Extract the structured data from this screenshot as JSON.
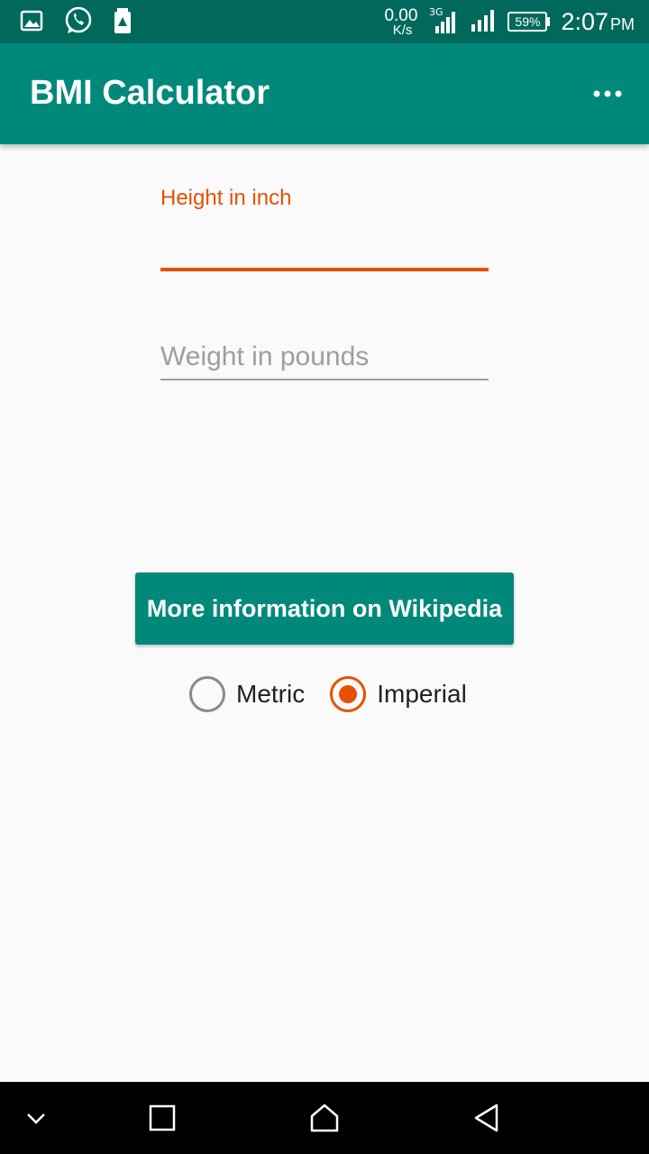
{
  "status_bar": {
    "net_speed": "0.00",
    "net_speed_unit": "K/s",
    "battery": "59%",
    "time": "2:07",
    "ampm": "PM",
    "icons": [
      "gallery-icon",
      "whatsapp-icon",
      "storage-icon",
      "signal-3g-icon",
      "signal-icon",
      "battery-icon"
    ]
  },
  "app_bar": {
    "title": "BMI Calculator",
    "overflow_icon": "more-vert-icon"
  },
  "form": {
    "height_label": "Height in inch",
    "height_value": "",
    "weight_placeholder": "Weight in pounds",
    "weight_value": ""
  },
  "wiki_button": {
    "label": "More information on Wikipedia"
  },
  "units": {
    "options": [
      "Metric",
      "Imperial"
    ],
    "selected": "Imperial"
  },
  "colors": {
    "primary": "#00897b",
    "primary_dark": "#00695c",
    "accent": "#e65100"
  },
  "nav_bar": {
    "icons": [
      "chevron-down-icon",
      "recents-icon",
      "home-icon",
      "back-icon"
    ]
  }
}
